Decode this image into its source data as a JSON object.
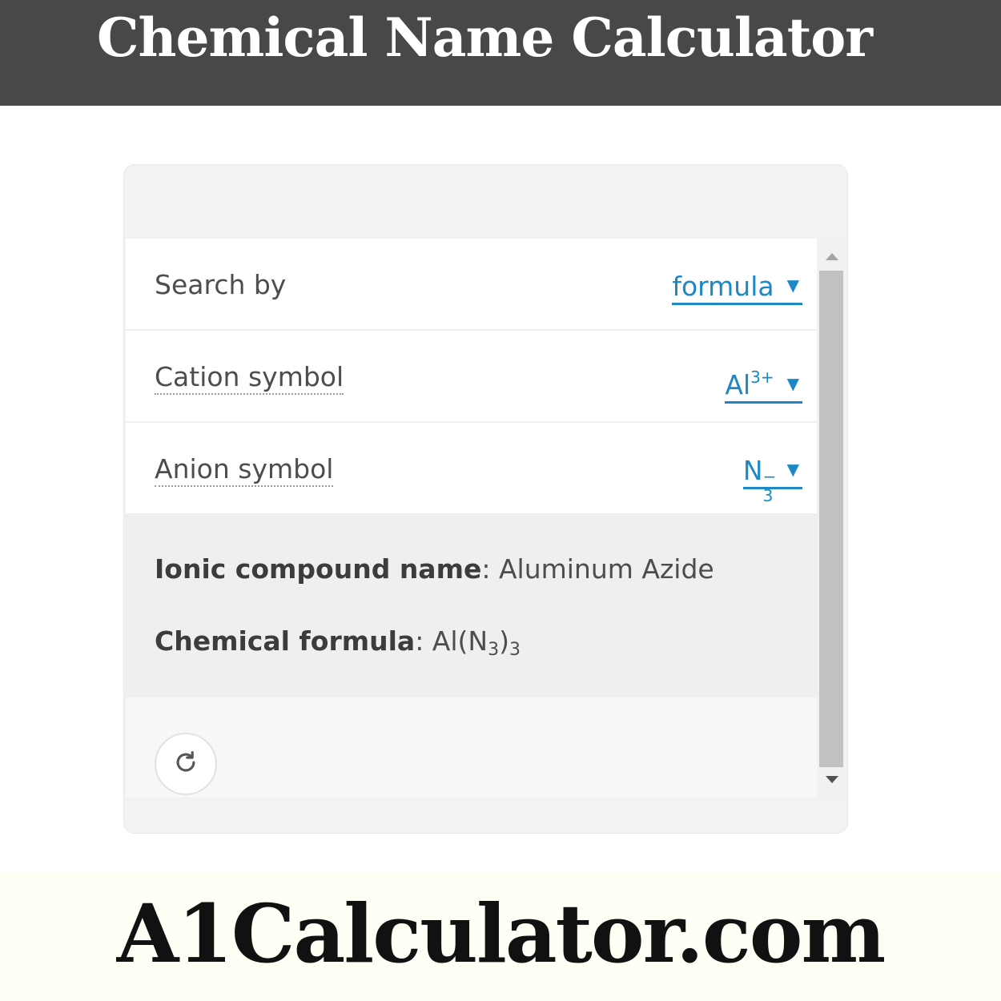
{
  "header": {
    "title": "Chemical Name Calculator"
  },
  "calculator": {
    "rows": [
      {
        "label": "Search by",
        "value": "formula"
      },
      {
        "label": "Cation symbol",
        "value_base": "Al",
        "value_sup": "3+"
      },
      {
        "label": "Anion symbol",
        "value_base": "N",
        "value_sub": "3",
        "value_sup": "−"
      }
    ],
    "result": {
      "name_label": "Ionic compound name",
      "name_value": "Aluminum Azide",
      "formula_label": "Chemical formula",
      "formula_parts": [
        "Al(N",
        "3",
        ")",
        "3"
      ]
    },
    "reset_icon": "refresh-icon",
    "caret": "▼"
  },
  "brand": {
    "text": "A1Calculator.com"
  }
}
